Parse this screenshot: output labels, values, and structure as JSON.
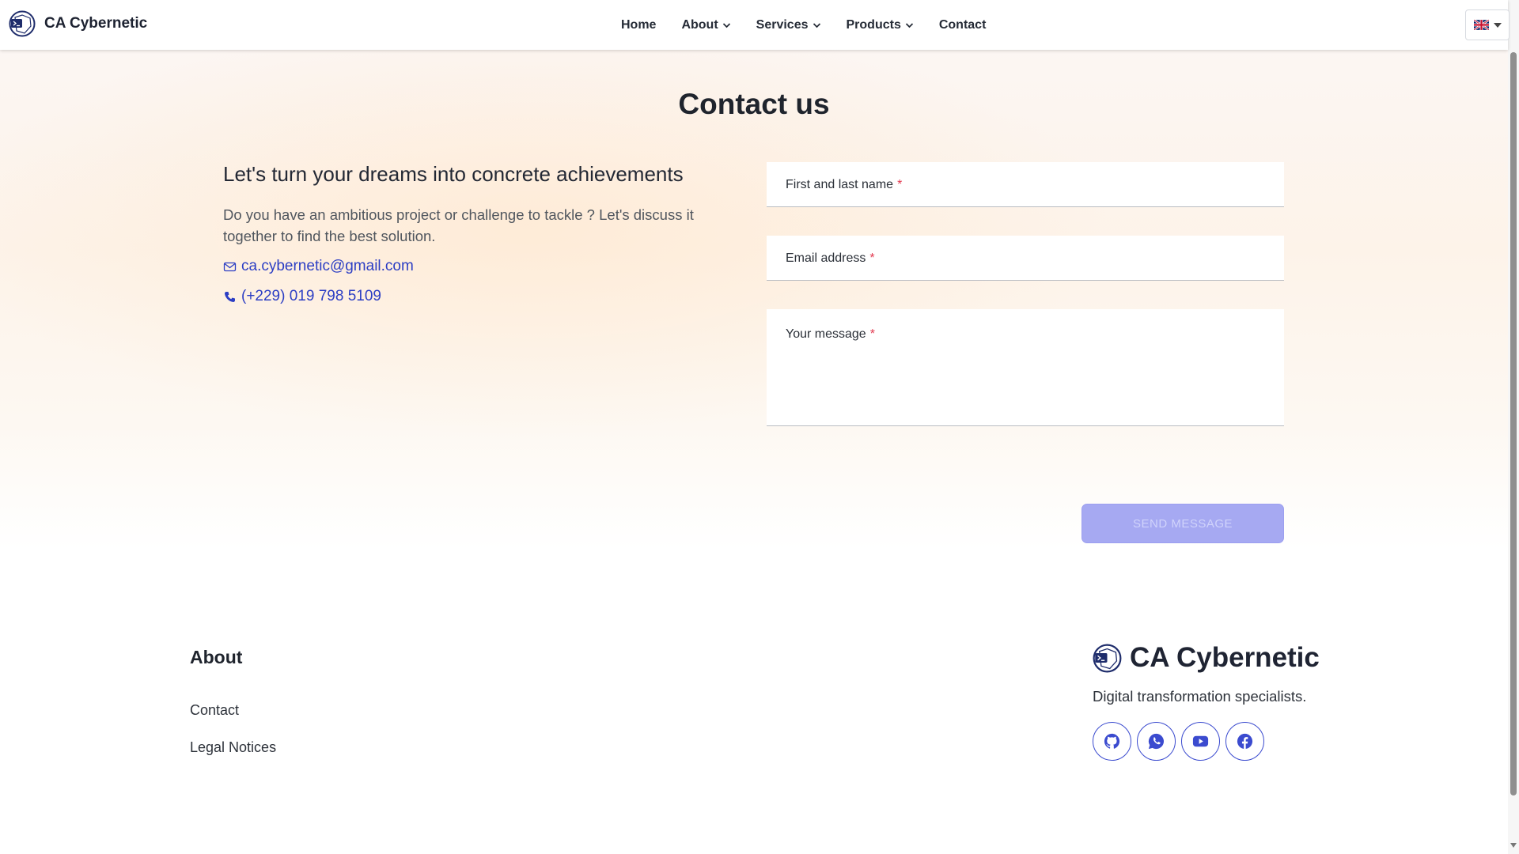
{
  "header": {
    "brand": "CA Cybernetic",
    "nav": [
      {
        "label": "Home",
        "dropdown": false
      },
      {
        "label": "About",
        "dropdown": true
      },
      {
        "label": "Services",
        "dropdown": true
      },
      {
        "label": "Products",
        "dropdown": true
      },
      {
        "label": "Contact",
        "dropdown": false
      }
    ],
    "language_icon": "uk-flag-icon"
  },
  "hero": {
    "title": "Contact us",
    "tagline": "Let's turn your dreams into concrete achievements",
    "intro": "Do you have an ambitious project or challenge to tackle ? Let's discuss it together to find the best solution.",
    "email": "ca.cybernetic@gmail.com",
    "phone": "(+229) 019 798 5109"
  },
  "form": {
    "name_label": "First and last name",
    "email_label": "Email address",
    "message_label": "Your message",
    "required_mark": "*",
    "submit_label": "SEND MESSAGE"
  },
  "footer": {
    "about_heading": "About",
    "links": [
      "Contact",
      "Legal Notices"
    ],
    "brand": "CA Cybernetic",
    "description": "Digital transformation specialists.",
    "socials": [
      "github-icon",
      "whatsapp-icon",
      "youtube-icon",
      "facebook-icon"
    ]
  },
  "colors": {
    "accent": "#2c3ec4",
    "button_disabled": "#a6a9f2",
    "required": "#e2394f"
  }
}
